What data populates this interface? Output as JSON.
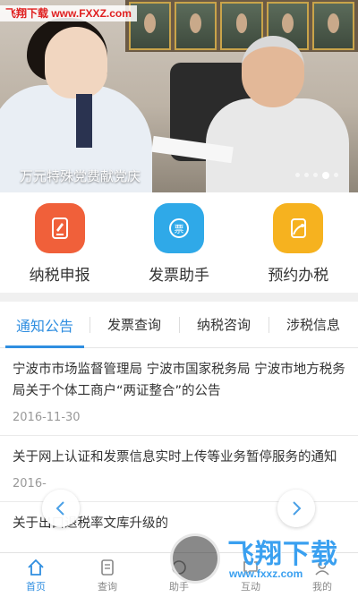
{
  "banner": {
    "watermark": "飞翔下载 www.FXXZ.com",
    "caption": "万元特殊党费献党庆",
    "slide_count": 5,
    "active_slide": 4
  },
  "quick_actions": [
    {
      "label": "纳税申报",
      "icon": "tax-form-icon",
      "color": "#f0603a"
    },
    {
      "label": "发票助手",
      "icon": "invoice-icon",
      "color": "#2fa9e8"
    },
    {
      "label": "预约办税",
      "icon": "appointment-icon",
      "color": "#f6b21f"
    }
  ],
  "tabs": [
    {
      "label": "通知公告",
      "active": true
    },
    {
      "label": "发票查询",
      "active": false
    },
    {
      "label": "纳税咨询",
      "active": false
    },
    {
      "label": "涉税信息",
      "active": false
    }
  ],
  "news": [
    {
      "title": "宁波市市场监督管理局 宁波市国家税务局 宁波市地方税务局关于个体工商户“两证整合”的公告",
      "date": "2016-11-30"
    },
    {
      "title": "关于网上认证和发票信息实时上传等业务暂停服务的通知",
      "date": "2016-"
    },
    {
      "title": "关于出口退税率文库升级的"
    }
  ],
  "bottom_nav": [
    {
      "label": "首页",
      "icon": "home-icon",
      "active": true
    },
    {
      "label": "查询",
      "icon": "query-icon",
      "active": false
    },
    {
      "label": "助手",
      "icon": "assistant-icon",
      "active": false
    },
    {
      "label": "互动",
      "icon": "interact-icon",
      "active": false
    },
    {
      "label": "我的",
      "icon": "profile-icon",
      "active": false
    }
  ],
  "watermark_bottom": {
    "brand": "飞翔下载",
    "url": "www.fxxz.com"
  },
  "colors": {
    "accent": "#2f8ee0"
  }
}
